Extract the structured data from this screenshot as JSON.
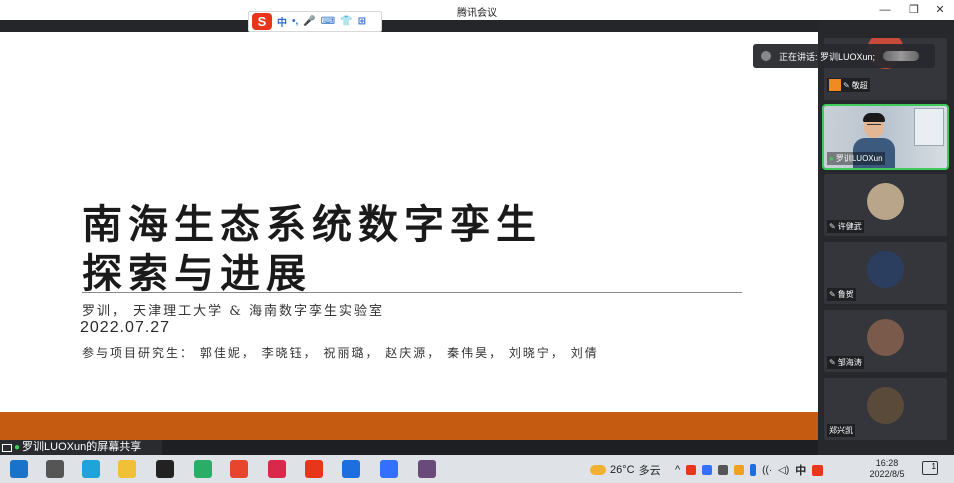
{
  "window": {
    "title": "腾讯会议",
    "minimize": "—",
    "restore": "❐",
    "close": "✕"
  },
  "ime": {
    "logo": "S",
    "items": [
      "中",
      "•,",
      "🎤",
      "⌨",
      "👕",
      "⊞"
    ]
  },
  "slide": {
    "title_line1": "南海生态系统数字孪生",
    "title_line2": "探索与进展",
    "author": "罗训， 天津理工大学 & 海南数字孪生实验室",
    "date": "2022.07.27",
    "students": "参与项目研究生： 郭佳妮， 李晓钰， 祝丽璐， 赵庆源， 秦伟昊， 刘晓宁， 刘倩"
  },
  "share_bar": {
    "label": "罗训LUOXun的屏幕共享"
  },
  "speaking": {
    "label": "正在讲话: 罗训LUOXun;"
  },
  "participants": [
    {
      "name": "敬超",
      "type": "avatar",
      "color": "#c84a3a"
    },
    {
      "name": "罗训LUOXun",
      "type": "video"
    },
    {
      "name": "许健武",
      "type": "avatar",
      "color": "#b8a58a"
    },
    {
      "name": "鲁贺",
      "type": "avatar",
      "color": "#2c3e60"
    },
    {
      "name": "邹海涛",
      "type": "avatar",
      "color": "#7a5a4a"
    },
    {
      "name": "郑兴凯",
      "type": "avatar",
      "color": "#5a4a3a"
    }
  ],
  "taskbar": {
    "weather_temp": "26°C",
    "weather_desc": "多云",
    "tray": [
      "^",
      "中"
    ],
    "time": "16:28",
    "date": "2022/8/5",
    "notifications": "1",
    "app_icons": [
      {
        "name": "start-icon",
        "color": "#1a73c8"
      },
      {
        "name": "task-view-icon",
        "color": "#555555"
      },
      {
        "name": "edge-icon",
        "color": "#1fa3d9"
      },
      {
        "name": "file-explorer-icon",
        "color": "#f2c037"
      },
      {
        "name": "qq-icon",
        "color": "#222222"
      },
      {
        "name": "wechat-icon",
        "color": "#2aae67"
      },
      {
        "name": "chrome-icon",
        "color": "#e8452f"
      },
      {
        "name": "app-red-icon",
        "color": "#d9284a"
      },
      {
        "name": "sogou-icon",
        "color": "#e8351b"
      },
      {
        "name": "tencent-meeting-icon",
        "color": "#1d6fe0"
      },
      {
        "name": "feishu-icon",
        "color": "#3370ff"
      },
      {
        "name": "game-icon",
        "color": "#6a4a7a"
      }
    ]
  }
}
